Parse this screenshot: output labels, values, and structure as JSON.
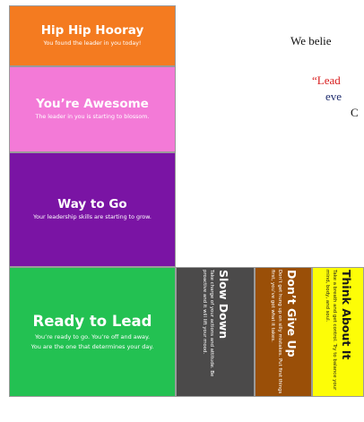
{
  "cards": {
    "hip": {
      "title": "Hip Hip Hooray",
      "subtitle": "You found the leader in you today!",
      "color": "#f47b20"
    },
    "awesome": {
      "title": "You’re Awesome",
      "subtitle": "The leader in you is starting to blossom.",
      "color": "#f37ad7"
    },
    "way": {
      "title": "Way to Go",
      "subtitle": "Your leadership skills are starting to grow.",
      "color": "#7a14a4"
    },
    "ready": {
      "title": "Ready to Lead",
      "subtitle_line1": "You’re ready to go.  You’re off and away.",
      "subtitle_line2": "You are the one that determines your day.",
      "color": "#23c152"
    },
    "slow": {
      "title": "Slow Down",
      "subtitle": "Take charge of your actions and attitude. Be proactive and it will lift your mood.",
      "color": "#4b4a4a"
    },
    "dont": {
      "title": "Don’t Give Up",
      "subtitle": "Don’t get hung up on silly mistakes. Put first things first, you’ve got what it takes.",
      "color": "#9a4f08"
    },
    "think": {
      "title": "Think About It",
      "subtitle": "Take a breath and get control. Try to balance your mind, body, and soul.",
      "color": "#fdfd07"
    }
  },
  "side_text": {
    "line1": "We belie",
    "line2": "“Lead",
    "line3": "eve",
    "line4": "C"
  }
}
